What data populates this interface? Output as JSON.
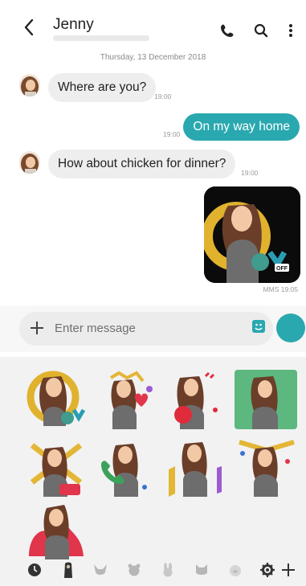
{
  "header": {
    "contact_name": "Jenny",
    "icons": [
      "back-arrow-icon",
      "phone-icon",
      "search-icon",
      "more-vert-icon"
    ]
  },
  "conversation": {
    "date": "Thursday, 13 December 2018",
    "messages": [
      {
        "direction": "incoming",
        "text": "Where are you?",
        "time": "19:00"
      },
      {
        "direction": "outgoing",
        "text": "On my way home",
        "time": "19:00"
      },
      {
        "direction": "incoming",
        "text": "How about chicken for dinner?",
        "time": "19:00"
      },
      {
        "direction": "outgoing",
        "type": "sticker",
        "sticker_text": "OK",
        "badge": "OFF",
        "time": "MMS 19:05"
      }
    ]
  },
  "composer": {
    "placeholder": "Enter message"
  },
  "sticker_panel": {
    "stickers": [
      {
        "name": "sticker-ok"
      },
      {
        "name": "sticker-love"
      },
      {
        "name": "sticker-angry"
      },
      {
        "name": "sticker-sad"
      },
      {
        "name": "sticker-no"
      },
      {
        "name": "sticker-phone"
      },
      {
        "name": "sticker-music"
      },
      {
        "name": "sticker-celebrate"
      },
      {
        "name": "sticker-fire"
      }
    ],
    "tabs": [
      "recent-icon",
      "figure-icon",
      "fox-icon",
      "bear-icon",
      "rabbit-icon",
      "cat-icon",
      "pig-icon",
      "settings-icon",
      "add-icon"
    ]
  },
  "colors": {
    "accent": "#2aa8b0",
    "incoming_bubble": "#eeeeee"
  }
}
